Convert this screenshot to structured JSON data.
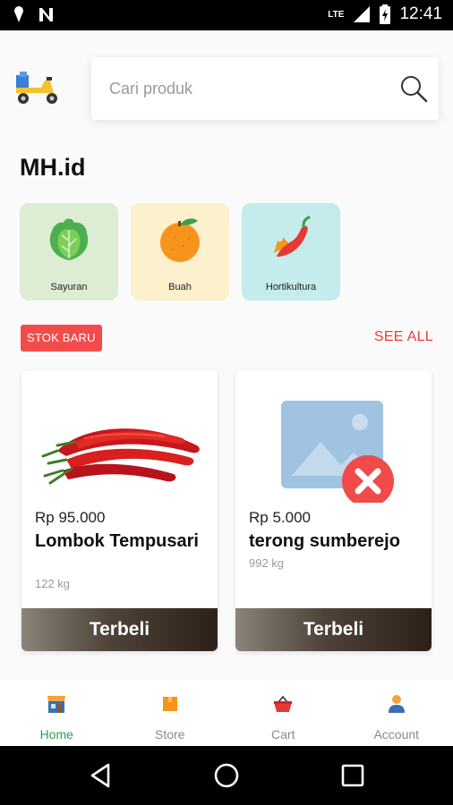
{
  "status_bar": {
    "time": "12:41",
    "network": "LTE",
    "icons": [
      "location-pin-icon",
      "notification-n-icon",
      "signal-icon",
      "battery-charging-icon"
    ]
  },
  "header": {
    "logo_icon": "delivery-scooter-icon",
    "search": {
      "placeholder": "Cari produk",
      "value": "",
      "icon": "search-icon"
    }
  },
  "store": {
    "title": "MH.id"
  },
  "categories": [
    {
      "label": "Sayuran",
      "icon": "lettuce-icon",
      "bg": "#dcedd3"
    },
    {
      "label": "Buah",
      "icon": "orange-fruit-icon",
      "bg": "#fdf0cc"
    },
    {
      "label": "Hortikultura",
      "icon": "chili-pepper-icon",
      "bg": "#c4ecec"
    }
  ],
  "section": {
    "badge": "STOK BARU",
    "see_all": "SEE ALL"
  },
  "products": [
    {
      "price": "Rp 95.000",
      "name": "Lombok Tempusari",
      "stock": "122 kg",
      "button": "Terbeli",
      "image": "red-chili-photo"
    },
    {
      "price": "Rp 5.000",
      "name": "terong sumberejo",
      "stock": "992 kg",
      "button": "Terbeli",
      "image": "broken-image-icon"
    }
  ],
  "bottom_nav": [
    {
      "label": "Home",
      "icon": "store-front-icon",
      "active": true
    },
    {
      "label": "Store",
      "icon": "box-icon",
      "active": false
    },
    {
      "label": "Cart",
      "icon": "basket-icon",
      "active": false
    },
    {
      "label": "Account",
      "icon": "person-icon",
      "active": false
    }
  ],
  "colors": {
    "accent_red": "#f24b4b",
    "active_green": "#2e9e4e"
  },
  "system_nav": [
    "back-icon",
    "home-circle-icon",
    "recents-square-icon"
  ]
}
